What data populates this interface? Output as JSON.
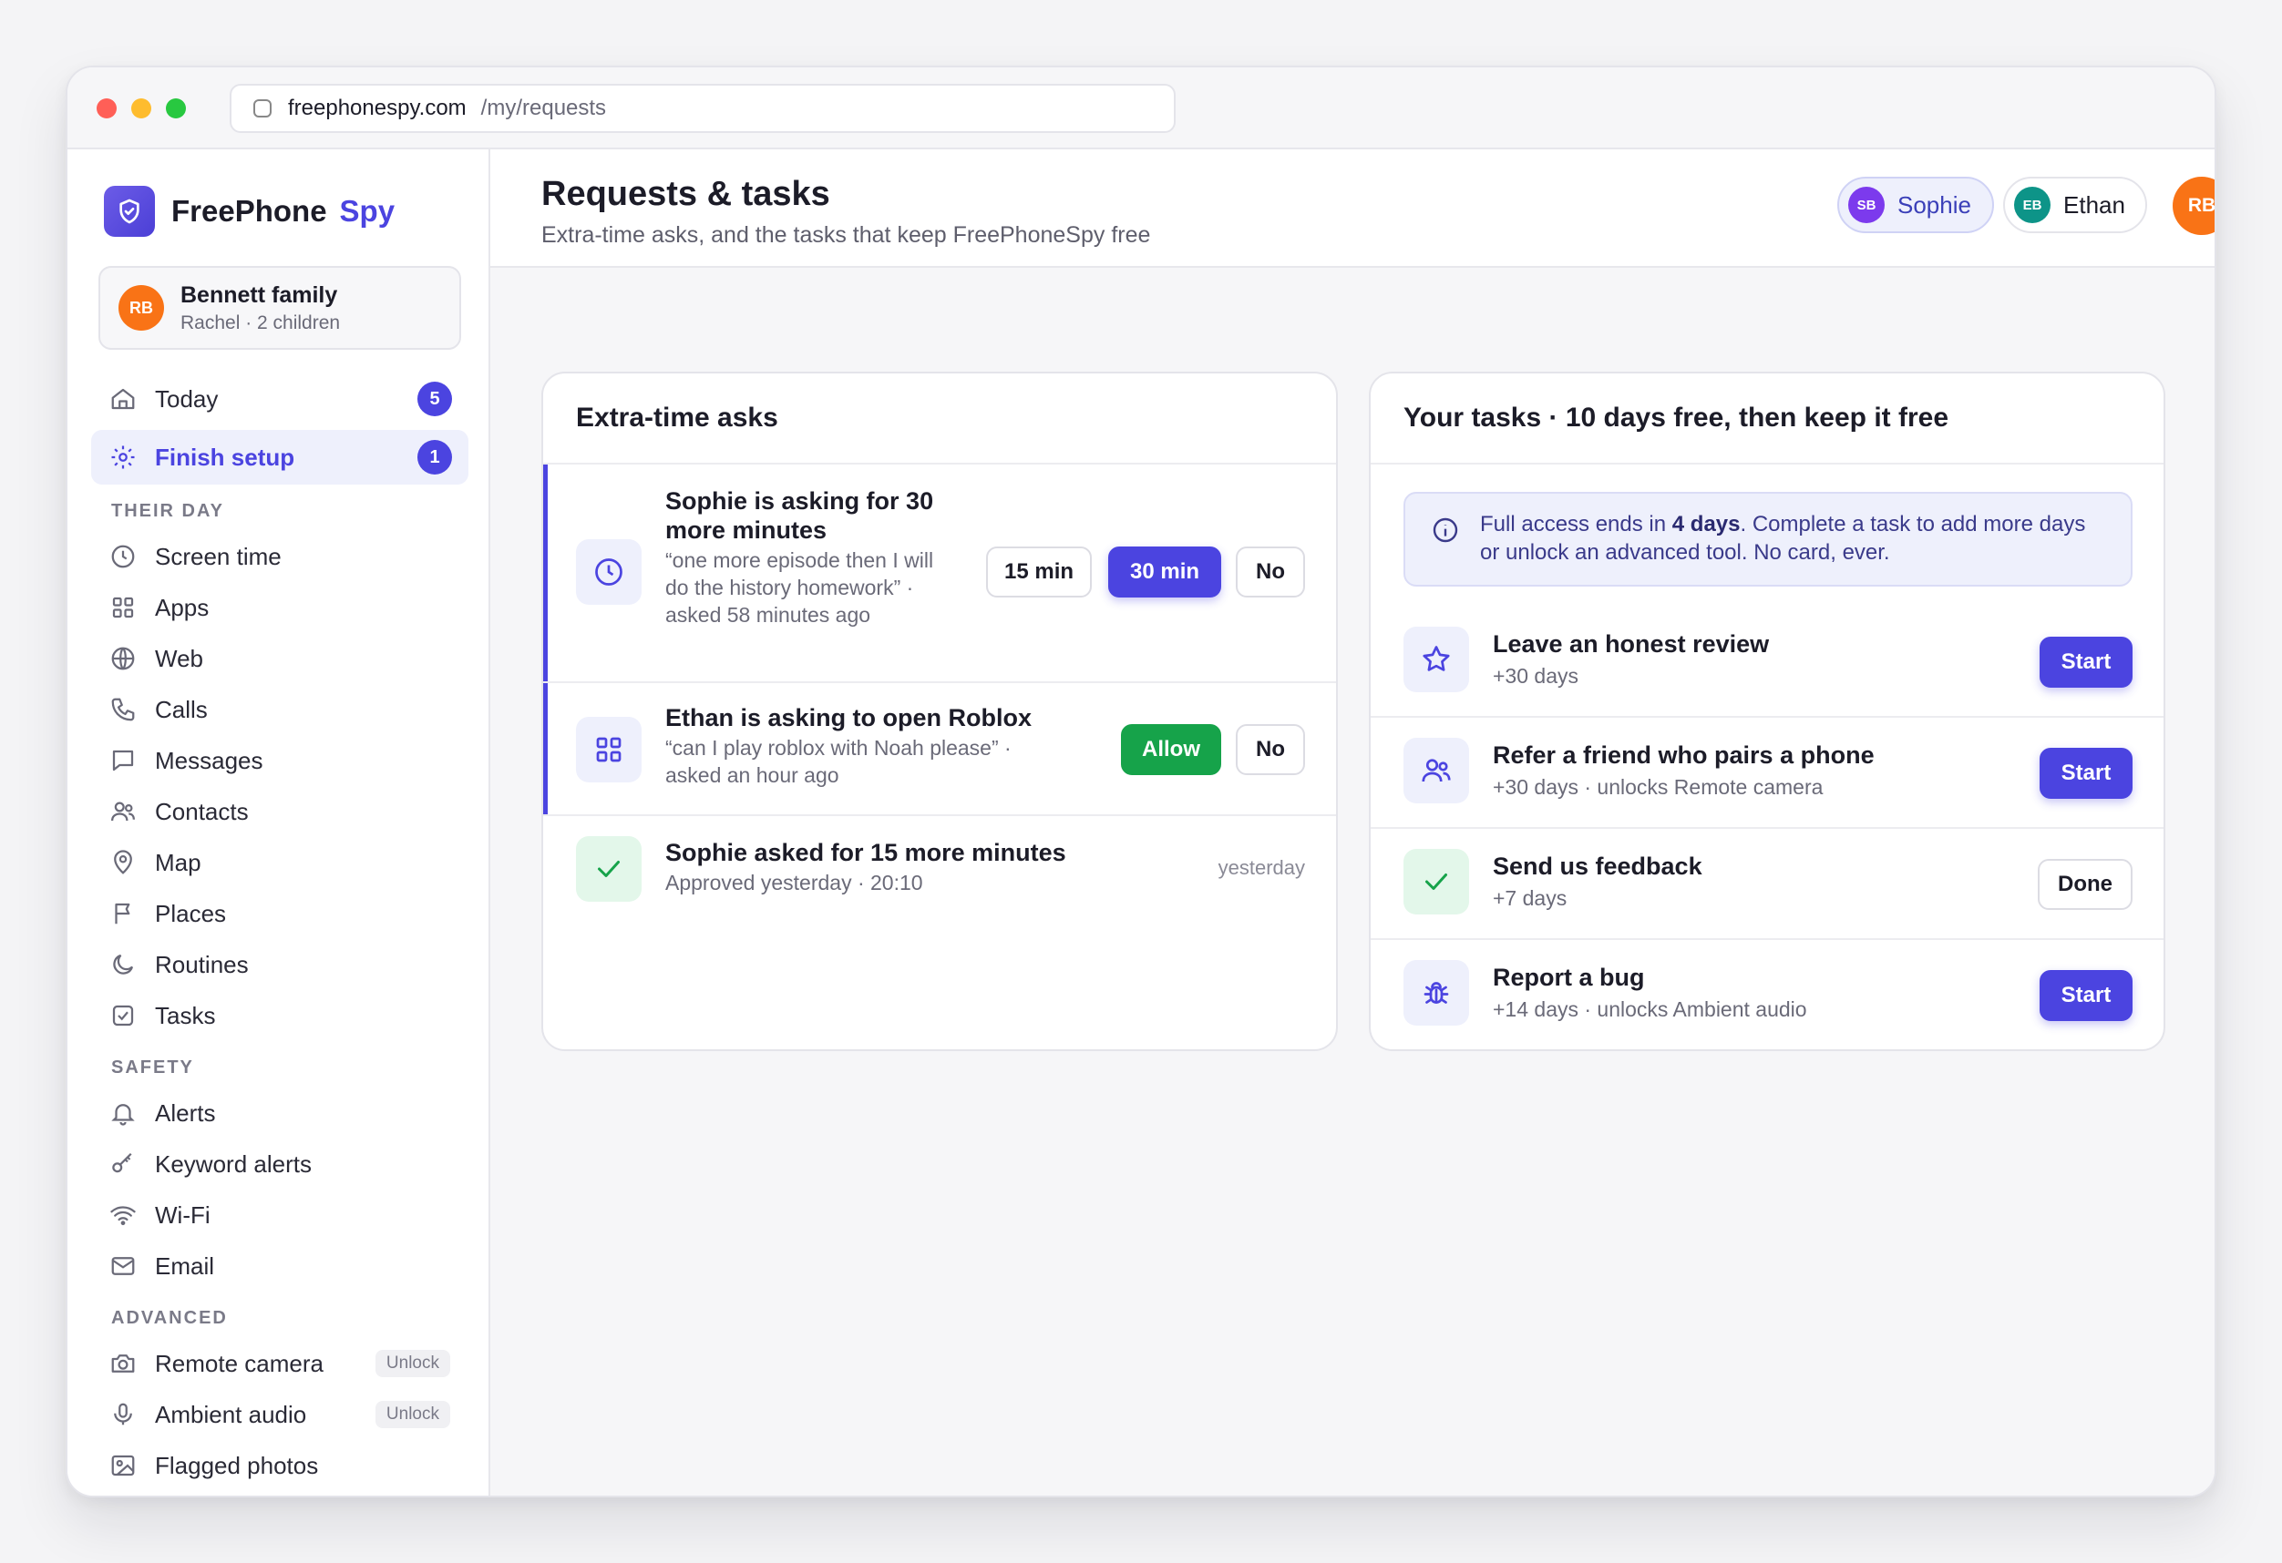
{
  "browser": {
    "host": "freephonespy.com",
    "path": "/my/requests"
  },
  "brand": {
    "name": "FreePhone",
    "accent": "Spy",
    "colors": {
      "accent": "#4b44e0",
      "avatar": "#f97316"
    }
  },
  "family": {
    "initials": "RB",
    "name": "Bennett family",
    "subtitle": "Rachel · 2 children"
  },
  "nav": {
    "primary": [
      {
        "label": "Today",
        "icon": "home-icon",
        "badge": "5"
      },
      {
        "label": "Finish setup",
        "icon": "gear-icon",
        "badge": "1",
        "active": true
      }
    ],
    "their_day_label": "THEIR DAY",
    "their_day": [
      {
        "label": "Screen time",
        "icon": "clock-icon"
      },
      {
        "label": "Apps",
        "icon": "grid-icon"
      },
      {
        "label": "Web",
        "icon": "globe-icon"
      },
      {
        "label": "Calls",
        "icon": "phone-icon"
      },
      {
        "label": "Messages",
        "icon": "message-icon"
      },
      {
        "label": "Contacts",
        "icon": "users-icon"
      },
      {
        "label": "Map",
        "icon": "pin-icon"
      },
      {
        "label": "Places",
        "icon": "flag-icon"
      },
      {
        "label": "Routines",
        "icon": "moon-icon"
      },
      {
        "label": "Tasks",
        "icon": "checkbox-icon"
      }
    ],
    "safety_label": "SAFETY",
    "safety": [
      {
        "label": "Alerts",
        "icon": "bell-icon"
      },
      {
        "label": "Keyword alerts",
        "icon": "key-icon"
      },
      {
        "label": "Wi-Fi",
        "icon": "wifi-icon"
      },
      {
        "label": "Email",
        "icon": "mail-icon"
      }
    ],
    "advanced_label": "ADVANCED",
    "advanced": [
      {
        "label": "Remote camera",
        "icon": "camera-icon",
        "pill": "Unlock"
      },
      {
        "label": "Ambient audio",
        "icon": "mic-icon",
        "pill": "Unlock"
      },
      {
        "label": "Flagged photos",
        "icon": "image-icon"
      }
    ]
  },
  "header": {
    "title": "Requests & tasks",
    "subtitle": "Extra-time asks, and the tasks that keep FreePhoneSpy free",
    "children": [
      {
        "initials": "SB",
        "name": "Sophie",
        "selected": true
      },
      {
        "initials": "EB",
        "name": "Ethan",
        "selected": false
      }
    ],
    "user_initials": "RB"
  },
  "asks": {
    "title": "Extra-time asks",
    "items": [
      {
        "title": "Sophie is asking for 30 more minutes",
        "subtitle": "“one more episode then I will do the history homework” · asked 58 minutes ago",
        "icon": "clock-icon",
        "actions": [
          "15 min",
          "30 min",
          "No"
        ]
      },
      {
        "title": "Ethan is asking to open Roblox",
        "subtitle": "“can I play roblox with Noah please” · asked an hour ago",
        "icon": "apps-grid-icon",
        "actions": [
          "Allow",
          "No"
        ]
      },
      {
        "title": "Sophie asked for 15 more minutes",
        "subtitle": "Approved yesterday · 20:10",
        "icon": "check-icon",
        "time": "yesterday"
      }
    ]
  },
  "tasks": {
    "title": "Your tasks · 10 days free, then keep it free",
    "info_prefix": "Full access ends in ",
    "info_bold": "4 days",
    "info_suffix": ". Complete a task to add more days or unlock an advanced tool. No card, ever.",
    "items": [
      {
        "title": "Leave an honest review",
        "subtitle": "+30 days",
        "icon": "star-icon",
        "action": "Start"
      },
      {
        "title": "Refer a friend who pairs a phone",
        "subtitle": "+30 days · unlocks Remote camera",
        "icon": "users-icon",
        "action": "Start"
      },
      {
        "title": "Send us feedback",
        "subtitle": "+7 days",
        "icon": "check-icon",
        "action": "Done"
      },
      {
        "title": "Report a bug",
        "subtitle": "+14 days · unlocks Ambient audio",
        "icon": "bug-icon",
        "action": "Start"
      }
    ]
  }
}
